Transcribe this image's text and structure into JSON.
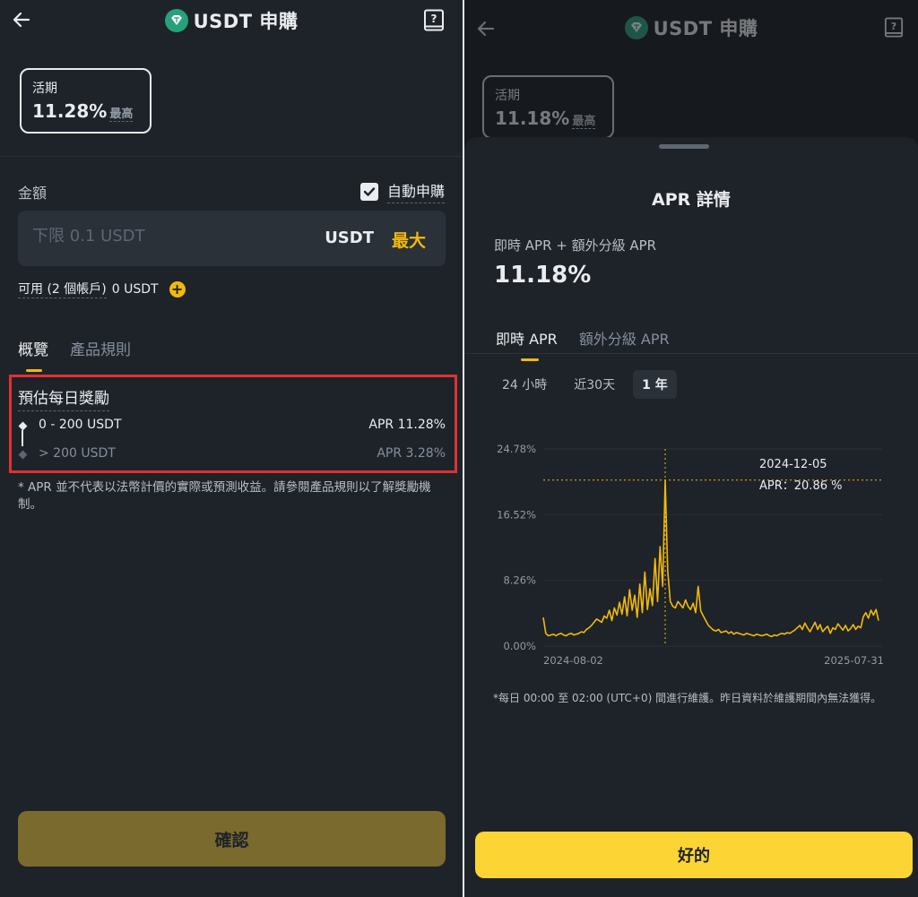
{
  "left": {
    "header": {
      "title": "USDT 申購"
    },
    "term": {
      "label": "活期",
      "rate": "11.28%",
      "max_label": "最高"
    },
    "amount": {
      "label": "金額",
      "placeholder": "下限 0.1 USDT",
      "unit": "USDT",
      "max_label": "最大"
    },
    "auto_subscribe": {
      "label": "自動申購",
      "checked": true
    },
    "available": {
      "label": "可用 (2 個帳戶)",
      "value": "0 USDT"
    },
    "tabs": [
      {
        "label": "概覽",
        "active": true
      },
      {
        "label": "產品規則",
        "active": false
      }
    ],
    "estimate": {
      "title": "預估每日獎勵",
      "tiers": [
        {
          "range": "0 - 200 USDT",
          "apr": "APR 11.28%"
        },
        {
          "range": "> 200 USDT",
          "apr": "APR 3.28%"
        }
      ]
    },
    "note": "* APR 並不代表以法幣計價的實際或預測收益。請參閱產品規則以了解獎勵機制。",
    "confirm_label": "確認"
  },
  "right": {
    "header": {
      "title": "USDT 申購"
    },
    "term": {
      "label": "活期",
      "rate": "11.18%",
      "max_label": "最高"
    },
    "sheet": {
      "title": "APR 詳情",
      "sub_label": "即時 APR + 額外分級 APR",
      "apr": "11.18%",
      "tabs": [
        {
          "label": "即時 APR",
          "active": true
        },
        {
          "label": "額外分級 APR",
          "active": false
        }
      ],
      "ranges": [
        {
          "label": "24 小時",
          "active": false
        },
        {
          "label": "近30天",
          "active": false
        },
        {
          "label": "1 年",
          "active": true
        }
      ],
      "note": "*每日 00:00 至 02:00 (UTC+0) 間進行維護。昨日資料於維護期間內無法獲得。",
      "ok_label": "好的"
    }
  },
  "colors": {
    "accent": "#f0b90b",
    "button_yellow": "#fcd535",
    "panel_bg": "#1e2329",
    "highlight_red": "#e03131",
    "coin_green": "#26a17b"
  },
  "chart_data": {
    "type": "line",
    "x_start": "2024-08-02",
    "x_end": "2025-07-31",
    "x_tick_labels": [
      "2024-08-02",
      "2025-07-31"
    ],
    "y_tick_labels": [
      "0.00%",
      "8.26%",
      "16.52%",
      "24.78%"
    ],
    "ylim": [
      0,
      24.78
    ],
    "grid": true,
    "tooltip": {
      "date": "2024-12-05",
      "label": "APR：20.86 %",
      "value": 20.86
    },
    "series": [
      {
        "values": [
          3.6,
          1.6,
          1.3,
          1.4,
          1.5,
          1.3,
          1.5,
          1.6,
          1.4,
          1.3,
          1.5,
          1.6,
          1.4,
          1.5,
          1.6,
          1.8,
          1.7,
          2.1,
          2.3,
          2.6,
          3.0,
          3.4,
          3.2,
          3.0,
          3.8,
          3.5,
          4.5,
          3.2,
          4.8,
          3.9,
          5.5,
          4.0,
          6.2,
          3.8,
          7.1,
          4.5,
          6.4,
          3.6,
          7.8,
          4.2,
          9.3,
          4.6,
          7.2,
          5.1,
          11.0,
          5.6,
          12.5,
          7.5,
          20.86,
          9.5,
          5.6,
          5.0,
          4.8,
          5.6,
          5.2,
          4.8,
          5.8,
          5.0,
          4.6,
          5.4,
          4.2,
          7.5,
          4.4,
          3.8,
          3.2,
          2.6,
          2.3,
          2.0,
          1.9,
          2.1,
          1.7,
          1.8,
          1.9,
          1.6,
          1.8,
          1.5,
          1.7,
          1.6,
          1.5,
          1.4,
          1.6,
          1.5,
          1.4,
          1.3,
          1.5,
          1.4,
          1.3,
          1.4,
          1.5,
          1.3,
          1.2,
          1.4,
          1.3,
          1.5,
          1.6,
          1.5,
          1.7,
          1.6,
          1.8,
          2.0,
          2.3,
          2.6,
          2.1,
          2.9,
          2.3,
          1.8,
          2.4,
          3.0,
          2.1,
          2.7,
          1.8,
          2.2,
          2.5,
          1.6,
          2.3,
          2.1,
          2.8,
          2.4,
          2.0,
          2.6,
          1.9,
          2.2,
          2.7,
          2.1,
          2.5,
          2.3,
          3.7,
          4.2,
          3.5,
          4.5,
          3.9,
          4.6,
          3.2
        ]
      }
    ]
  }
}
